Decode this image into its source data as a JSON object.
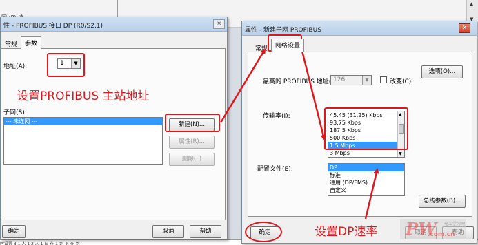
{
  "background": {
    "title_fragment": "回 (P) 读",
    "bottom_text": "时设置 3 1 人 1 2 人 1 日 在 1 到 下 在 到"
  },
  "left_dialog": {
    "title": "性 - PROFIBUS 接口 DP (R0/S2.1)",
    "close_label": "☒",
    "tabs": [
      "常规",
      "参数"
    ],
    "address_label": "地址(A):",
    "address_value": "1",
    "subnet_label": "子网(S):",
    "subnet_items": [
      "--- 未连网 ---"
    ],
    "buttons": {
      "new": "新建(N)...",
      "properties": "属性(R)...",
      "delete": "删除(L)"
    },
    "footer": {
      "ok": "确定",
      "cancel": "取消",
      "help": "帮助"
    }
  },
  "right_dialog": {
    "title": "属性 - 新建子网 PROFIBUS",
    "close_label": "✕",
    "tabs": [
      "常规",
      "网络设置"
    ],
    "highest_addr_label": "最高的 PROFIBUS 地址(H):",
    "highest_addr_value": "126",
    "change_label": "改变(C)",
    "options_button": "选项(O)...",
    "baud_label": "传输率(I):",
    "baud_rates": [
      "45.45 (31.25) Kbps",
      "93.75 Kbps",
      "187.5 Kbps",
      "500 Kbps",
      "1.5 Mbps",
      "3 Mbps"
    ],
    "baud_selected": "1.5 Mbps",
    "profile_label": "配置文件(E):",
    "profiles": [
      "DP",
      "标准",
      "通用 (DP/FMS)",
      "自定义"
    ],
    "profile_selected": "DP",
    "bus_params_button": "总线参数(B)...",
    "footer": {
      "ok": "确定",
      "cancel": "取消",
      "help": "帮助"
    }
  },
  "annotations": {
    "master_address": "设置PROFIBUS 主站地址",
    "dp_rate": "设置DP速率"
  },
  "watermark": {
    "big": "PW",
    "small": ".com.cn",
    "tiny": "电工学习网"
  },
  "colors": {
    "annotation_red": "#e0161d",
    "selection_blue": "#3399ff"
  }
}
